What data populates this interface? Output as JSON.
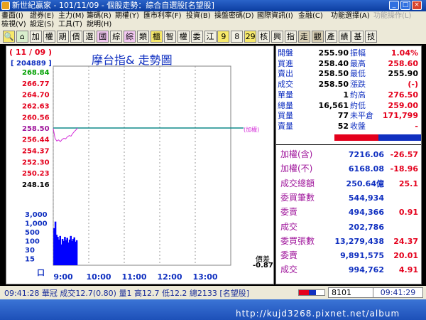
{
  "window": {
    "title": "新世紀贏家 - 101/11/09 - 個股走勢：綜合自選股[名望股]"
  },
  "menu": [
    {
      "label": "畫面(I)",
      "enabled": true
    },
    {
      "label": "證券(E)",
      "enabled": true
    },
    {
      "label": "主力(M)",
      "enabled": true
    },
    {
      "label": "籌碼(R)",
      "enabled": true
    },
    {
      "label": "期權(Y)",
      "enabled": true
    },
    {
      "label": "匯市利率(F)",
      "enabled": true
    },
    {
      "label": "投資(B)",
      "enabled": true
    },
    {
      "label": "操盤密碼(D)",
      "enabled": true
    },
    {
      "label": "國際資訊(I)",
      "enabled": true
    },
    {
      "label": "金融(C)",
      "enabled": true
    },
    {
      "label": "功能選擇(A)",
      "enabled": true
    },
    {
      "label": "功能操作(L)",
      "enabled": false
    },
    {
      "label": "檢視(V)",
      "enabled": true
    },
    {
      "label": "設定(S)",
      "enabled": true
    },
    {
      "label": "工具(T)",
      "enabled": true
    },
    {
      "label": "說明(H)",
      "enabled": true
    }
  ],
  "toolbar": {
    "buttons": [
      {
        "label": "🔍",
        "icon": "search-icon",
        "style": "y"
      },
      {
        "label": "⌂",
        "icon": "home-icon",
        "style": "g"
      },
      {
        "label": "加",
        "style": ""
      },
      {
        "label": "權",
        "style": ""
      },
      {
        "label": "期",
        "style": ""
      },
      {
        "label": "價",
        "style": ""
      },
      {
        "label": "選",
        "style": ""
      },
      {
        "label": "國",
        "style": "p"
      },
      {
        "label": "綜",
        "style": ""
      },
      {
        "label": "綜",
        "style": "p"
      },
      {
        "label": "類",
        "style": ""
      },
      {
        "label": "櫃",
        "style": "y"
      },
      {
        "label": "智",
        "style": ""
      },
      {
        "label": "權",
        "style": ""
      },
      {
        "label": "委",
        "style": ""
      },
      {
        "label": "江",
        "style": ""
      },
      {
        "label": "9",
        "style": "y"
      },
      {
        "label": "8",
        "style": ""
      },
      {
        "label": "29",
        "style": "y"
      },
      {
        "label": "核",
        "style": ""
      },
      {
        "label": "興",
        "style": ""
      },
      {
        "label": "指",
        "style": ""
      },
      {
        "label": "走",
        "style": "on"
      },
      {
        "label": "觀",
        "style": "on"
      },
      {
        "label": "產",
        "style": ""
      },
      {
        "label": "績",
        "style": ""
      },
      {
        "label": "基",
        "style": ""
      },
      {
        "label": "技",
        "style": ""
      }
    ]
  },
  "chart": {
    "title": "摩台指&  走勢圖",
    "date": "( 11 / 09 )",
    "code": "[ 204889 ]",
    "reference_label": "(加權)",
    "diff_label": "價差",
    "diff_value": "-0.87",
    "volume_unit": "口",
    "colors": {
      "up": "#e4001c",
      "down": "#00a000",
      "neutral": "#000000",
      "line": "#d42ed9",
      "ref": "#108a8a",
      "volume": "#0000ff",
      "axis": "#1030c0"
    }
  },
  "chart_data": {
    "type": "line",
    "title": "摩台指&  走勢圖",
    "price_axis": {
      "ticks": [
        "268.84",
        "266.77",
        "264.70",
        "262.63",
        "260.56",
        "258.50",
        "256.44",
        "254.37",
        "252.30",
        "250.23",
        "248.16"
      ],
      "min": 248.16,
      "max": 268.84,
      "reference": 258.5
    },
    "volume_axis": {
      "ticks": [
        "3,000",
        "1,000",
        "500",
        "100",
        "30",
        "15"
      ],
      "unit": "口"
    },
    "x_ticks": [
      "9:00",
      "10:00",
      "11:00",
      "12:00",
      "13:00"
    ],
    "x_range_minutes": [
      0,
      300
    ],
    "series": [
      {
        "name": "price",
        "t": [
          0,
          3,
          6,
          9,
          12,
          15,
          18,
          21,
          24,
          27,
          30,
          33,
          36,
          39,
          41
        ],
        "values": [
          258.4,
          256.6,
          256.1,
          256.3,
          256.0,
          256.4,
          256.6,
          256.5,
          256.9,
          257.1,
          257.0,
          257.5,
          257.9,
          258.2,
          258.5
        ]
      },
      {
        "name": "volume",
        "t": [
          2,
          4,
          6,
          8,
          10,
          12,
          14,
          16,
          18,
          20,
          22,
          24,
          26,
          28,
          30,
          32,
          34,
          36,
          38,
          40
        ],
        "values": [
          500,
          1000,
          250,
          200,
          150,
          220,
          90,
          160,
          130,
          200,
          140,
          180,
          110,
          150,
          220,
          130,
          160,
          190,
          120,
          140
        ]
      }
    ]
  },
  "quote": {
    "rows": [
      {
        "l1": "開盤",
        "v1": "255.90",
        "c1": "neutral",
        "l2": "振幅",
        "v2": "1.04%",
        "c2": "up"
      },
      {
        "l1": "買進",
        "v1": "258.40",
        "c1": "neutral",
        "l2": "最高",
        "v2": "258.60",
        "c2": "up"
      },
      {
        "l1": "賣出",
        "v1": "258.50",
        "c1": "neutral",
        "l2": "最低",
        "v2": "255.90",
        "c2": "neutral"
      },
      {
        "l1": "成交",
        "v1": "258.50",
        "c1": "neutral",
        "l2": "漲跌",
        "v2": "(-)",
        "c2": "up"
      },
      {
        "l1": "單量",
        "v1": "1",
        "c1": "neutral",
        "l2": "約高",
        "v2": "276.50",
        "c2": "up"
      },
      {
        "l1": "總量",
        "v1": "16,561",
        "c1": "neutral",
        "l2": "約低",
        "v2": "259.00",
        "c2": "up"
      },
      {
        "l1": "買量",
        "v1": "77",
        "c1": "neutral",
        "l2": "未平倉",
        "v2": "171,799",
        "c2": "up"
      },
      {
        "l1": "賣量",
        "v1": "52",
        "c1": "neutral",
        "l2": "收盤",
        "v2": "-",
        "c2": "up"
      }
    ]
  },
  "stats": {
    "rows": [
      {
        "label": "加權(含)",
        "value": "7216.06",
        "change": "-26.57"
      },
      {
        "label": "加權(不)",
        "value": "6168.08",
        "change": "-18.96"
      },
      {
        "label": "成交總額",
        "value": "250.64億",
        "change": "25.1"
      },
      {
        "label": "委買筆數",
        "value": "544,934",
        "change": ""
      },
      {
        "label": "委賣",
        "value": "494,366",
        "change": "0.91"
      },
      {
        "label": "成交",
        "value": "202,786",
        "change": ""
      },
      {
        "label": "委買張數",
        "value": "13,279,438",
        "change": "24.37"
      },
      {
        "label": "委賣",
        "value": "9,891,575",
        "change": "20.01"
      },
      {
        "label": "成交",
        "value": "994,762",
        "change": "4.91"
      }
    ]
  },
  "status": {
    "ticker": "09:41:28 華冠 成交12.7(0.80) 量1 高12.7 低12.2 總2133 [名望股]",
    "code": "8101",
    "time": "09:41:29"
  },
  "taskbar": {
    "url": "http://kujd3268.pixnet.net/album"
  }
}
